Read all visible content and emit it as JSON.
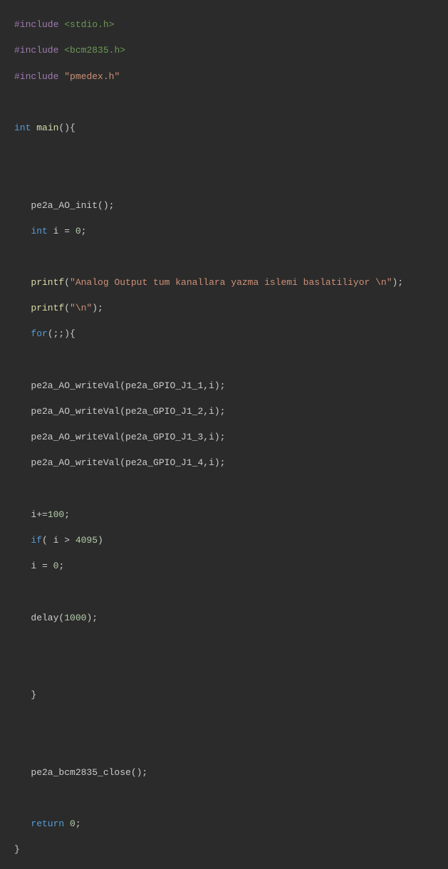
{
  "code": {
    "include1_directive": "#include",
    "include1_value": "<stdio.h>",
    "include2_directive": "#include",
    "include2_value": "<bcm2835.h>",
    "include3_directive": "#include",
    "include3_value": "\"pmedex.h\"",
    "type_int": "int",
    "func_main": "main",
    "main_params": "(){",
    "call_init": "pe2a_AO_init();",
    "decl_i_type": "int",
    "decl_i_rest": " i = ",
    "decl_i_val": "0",
    "decl_i_semi": ";",
    "printf1_func": "printf",
    "printf1_open": "(",
    "printf1_str": "\"Analog Output tum kanallara yazma islemi baslatiliyor \\n\"",
    "printf1_close": ");",
    "printf2_func": "printf",
    "printf2_open": "(",
    "printf2_str": "\"\\n\"",
    "printf2_close": ");",
    "for_kw": "for",
    "for_rest": "(;;){",
    "write1": "pe2a_AO_writeVal(pe2a_GPIO_J1_1,i);",
    "write2": "pe2a_AO_writeVal(pe2a_GPIO_J1_2,i);",
    "write3": "pe2a_AO_writeVal(pe2a_GPIO_J1_3,i);",
    "write4": "pe2a_AO_writeVal(pe2a_GPIO_J1_4,i);",
    "iplus_pre": "i+=",
    "iplus_val": "100",
    "iplus_semi": ";",
    "if_kw": "if",
    "if_open": "( i > ",
    "if_val": "4095",
    "if_close": ")",
    "i_reset_pre": "i = ",
    "i_reset_val": "0",
    "i_reset_semi": ";",
    "delay_func": "delay(",
    "delay_val": "1000",
    "delay_close": ");",
    "brace_close_for": "}",
    "close_call": "pe2a_bcm2835_close();",
    "return_kw": "return",
    "return_sp": " ",
    "return_val": "0",
    "return_semi": ";",
    "brace_close_main": "}"
  }
}
